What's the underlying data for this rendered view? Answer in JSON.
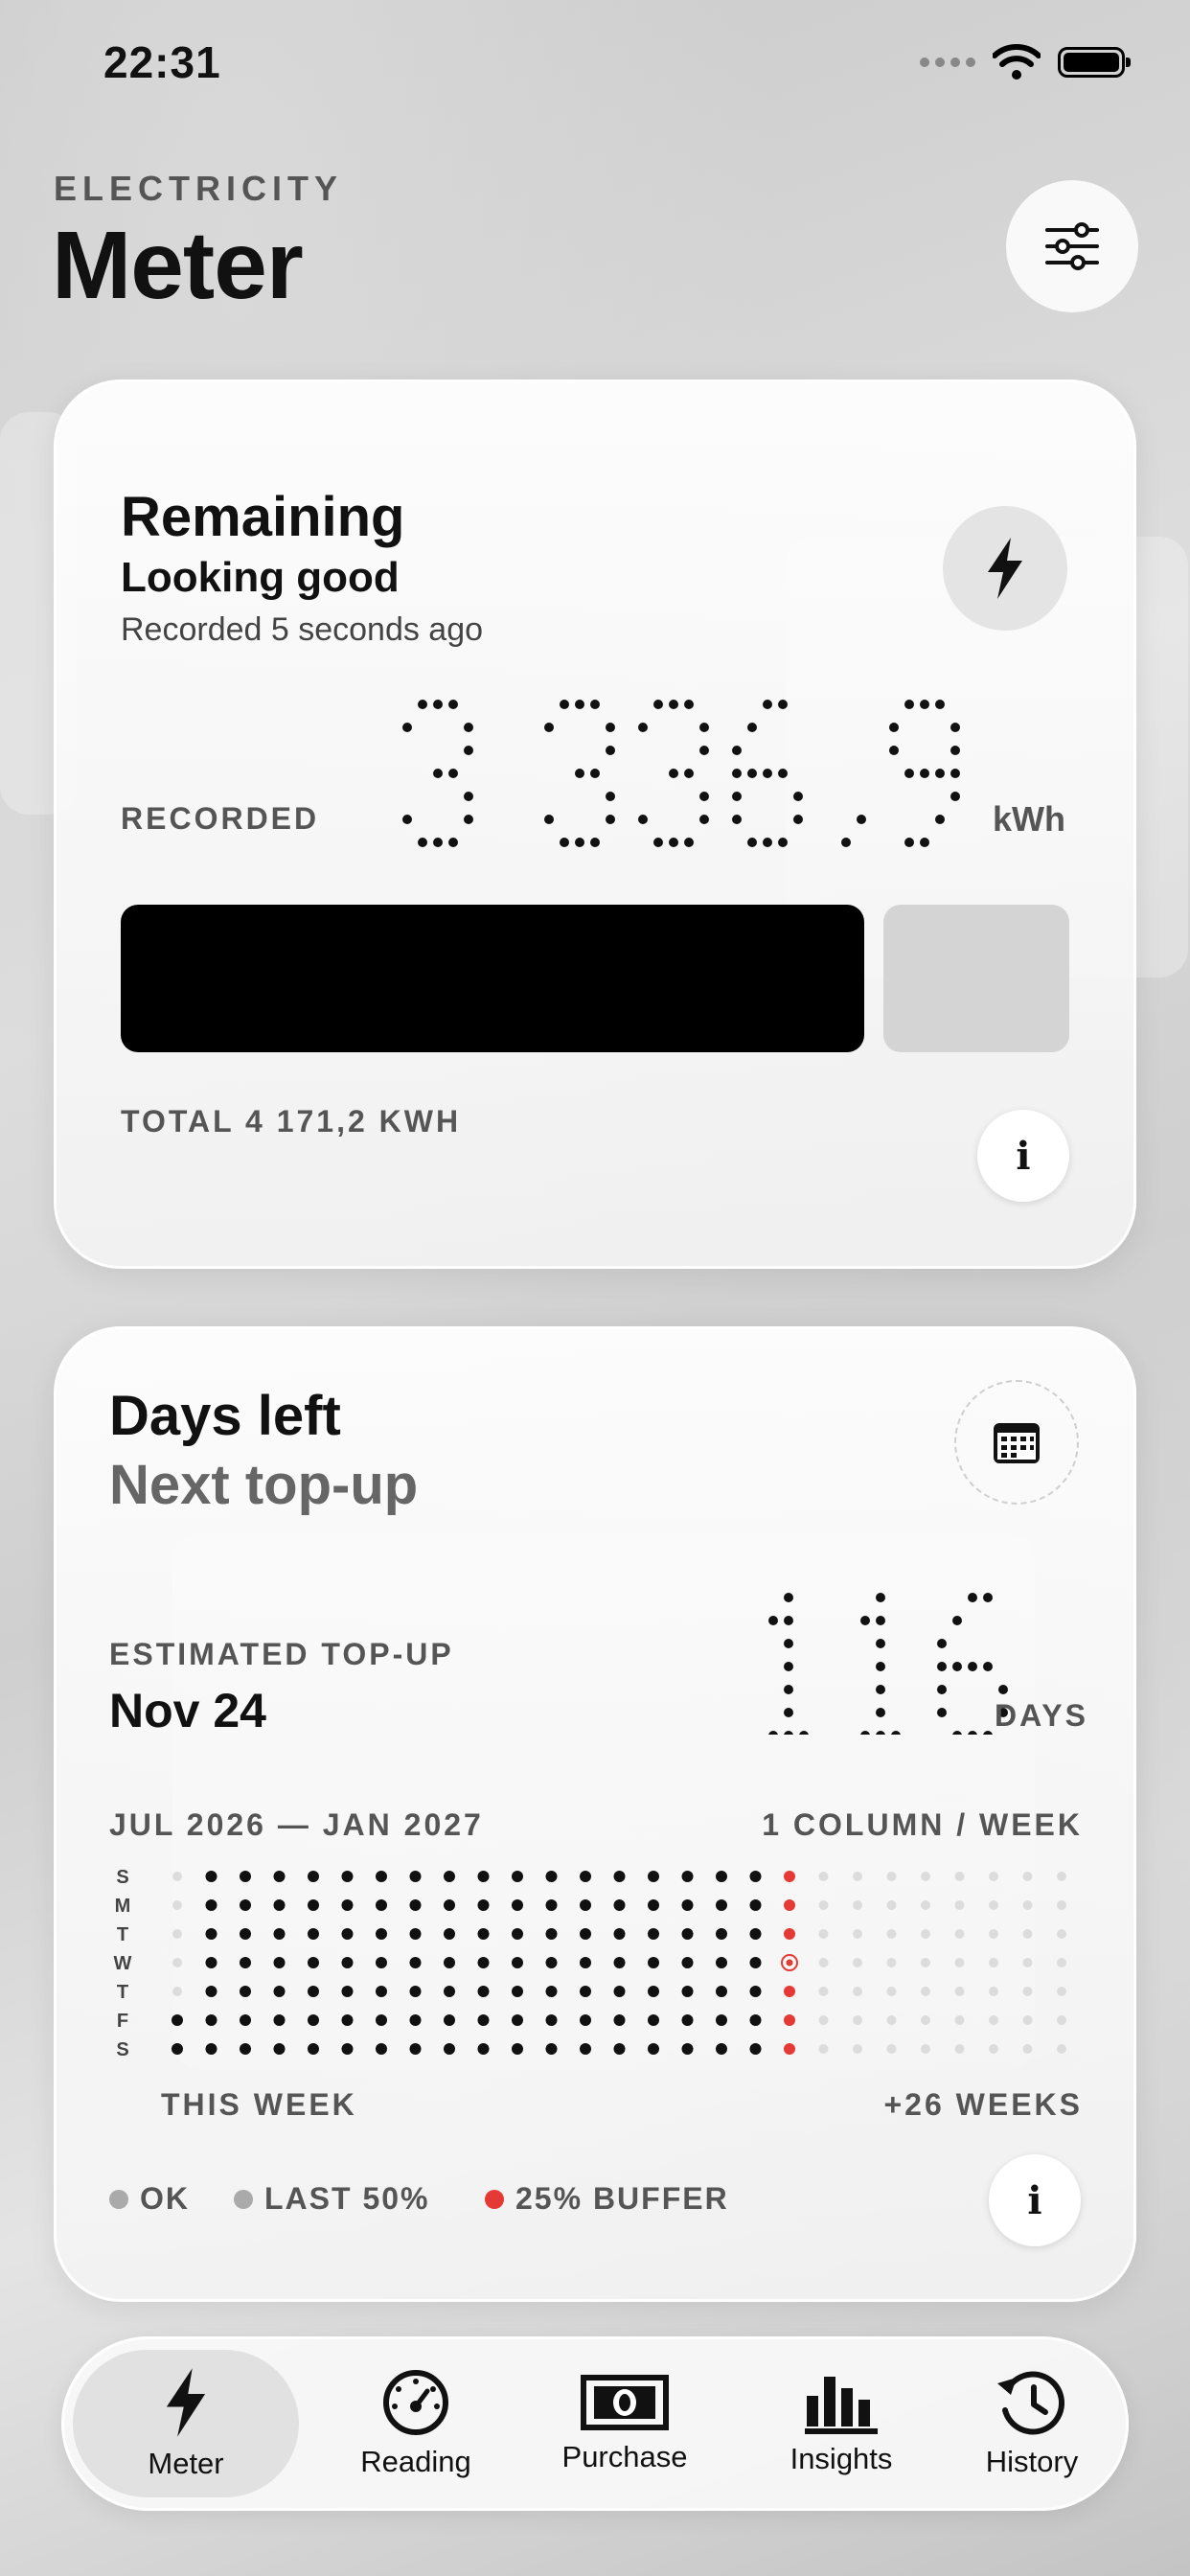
{
  "status": {
    "time": "22:31"
  },
  "header": {
    "kicker": "ELECTRICITY",
    "title": "Meter"
  },
  "remaining": {
    "title": "Remaining",
    "status": "Looking good",
    "recorded_ago": "Recorded 5 seconds ago",
    "recorded_label": "RECORDED",
    "value": "3 336,9",
    "unit": "kWh",
    "used_fraction": 0.8,
    "total": "TOTAL 4 171,2 KWH"
  },
  "days": {
    "title": "Days left",
    "subtitle": "Next top-up",
    "estimate_label": "ESTIMATED TOP-UP",
    "estimate_date": "Nov 24",
    "value": "116",
    "unit": "DAYS",
    "range": "JUL 2026 — JAN 2027",
    "scale": "1 COLUMN / WEEK",
    "weekday_labels": [
      "S",
      "M",
      "T",
      "W",
      "T",
      "F",
      "S"
    ],
    "this_week": "THIS WEEK",
    "future": "+26 WEEKS",
    "legend": [
      {
        "label": "OK",
        "color": "#aaaaaa"
      },
      {
        "label": "LAST 50%",
        "color": "#aaaaaa"
      },
      {
        "label": "25% BUFFER",
        "color": "#e53935"
      }
    ]
  },
  "tabs": [
    {
      "label": "Meter",
      "icon": "bolt-icon",
      "active": true
    },
    {
      "label": "Reading",
      "icon": "gauge-icon",
      "active": false
    },
    {
      "label": "Purchase",
      "icon": "banknote-icon",
      "active": false
    },
    {
      "label": "Insights",
      "icon": "bar-chart-icon",
      "active": false
    },
    {
      "label": "History",
      "icon": "history-icon",
      "active": false
    }
  ]
}
